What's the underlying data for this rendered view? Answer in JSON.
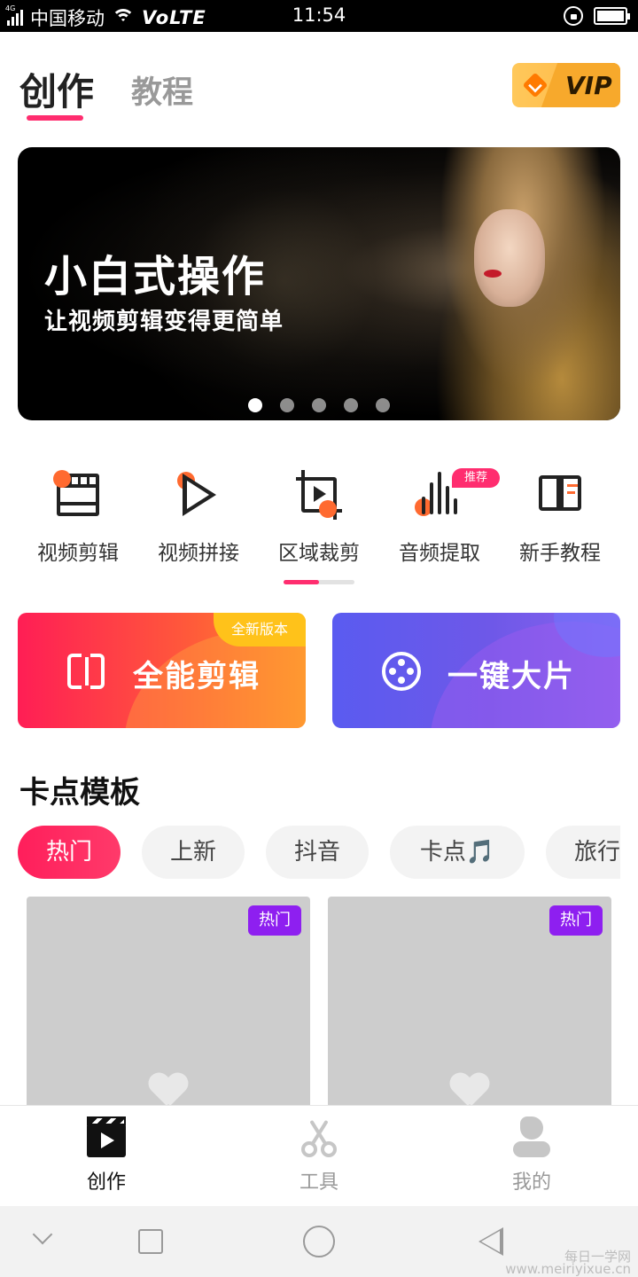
{
  "status_bar": {
    "network_tag": "4G",
    "carrier": "中国移动",
    "volte": "VoLTE",
    "time": "11:54"
  },
  "header": {
    "tab_create": "创作",
    "tab_tutorial": "教程",
    "vip_label": "VIP",
    "active_tab_color": "#ff2d6f"
  },
  "banner": {
    "title": "小白式操作",
    "subtitle": "让视频剪辑变得更简单",
    "page_count": 5,
    "active_page": 1
  },
  "tools": [
    {
      "label": "视频剪辑",
      "icon": "film-edit-icon"
    },
    {
      "label": "视频拼接",
      "icon": "video-join-icon"
    },
    {
      "label": "区域裁剪",
      "icon": "crop-icon"
    },
    {
      "label": "音频提取",
      "icon": "audio-extract-icon",
      "badge": "推荐"
    },
    {
      "label": "新手教程",
      "icon": "tutorial-book-icon"
    }
  ],
  "feature_cards": {
    "full_edit": {
      "label": "全能剪辑",
      "badge": "全新版本",
      "icon": "split-edit-icon"
    },
    "one_click": {
      "label": "一键大片",
      "icon": "film-reel-icon"
    }
  },
  "section": {
    "title": "卡点模板",
    "chips": [
      "热门",
      "上新",
      "抖音",
      "卡点🎵",
      "旅行"
    ],
    "active_chip": "热门"
  },
  "templates": [
    {
      "badge": "热门"
    },
    {
      "badge": "热门"
    }
  ],
  "bottom_nav": {
    "items": [
      {
        "label": "创作",
        "icon": "clapperboard-icon",
        "active": true
      },
      {
        "label": "工具",
        "icon": "scissors-icon",
        "active": false
      },
      {
        "label": "我的",
        "icon": "user-icon",
        "active": false
      }
    ]
  },
  "watermark": {
    "line1": "每日一学网",
    "line2": "www.meiriyixue.cn"
  },
  "colors": {
    "accent": "#ff2d6f",
    "vip_gold": "#ffb443",
    "hot_badge": "#8e1ff0",
    "card_edit": "#ff1e55",
    "card_movie": "#5a5bf0"
  }
}
